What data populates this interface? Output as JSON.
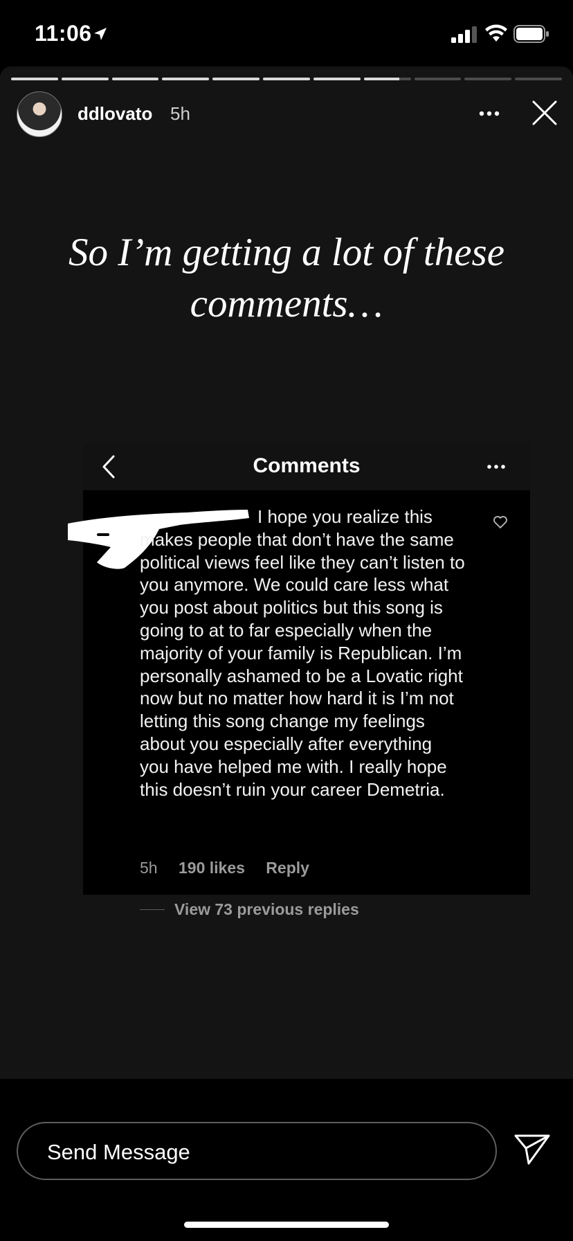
{
  "status_bar": {
    "time": "11:06"
  },
  "story": {
    "progress": {
      "segments": 11,
      "completed": 7,
      "current_fraction": 0.75
    },
    "username": "ddlovato",
    "time_ago": "5h",
    "headline": "So I’m getting a lot of these comments…"
  },
  "screenshot": {
    "title": "Comments",
    "comment_text": "I hope you realize this makes people that don’t have the same political views feel like they can’t listen to you anymore. We could care less what you post about politics but this song is going to at to far especially when the majority of your family is Republican. I’m personally ashamed to be a Lovatic right now but no matter how hard it is I’m not letting this song change my feelings about you especially after everything you have helped me with. I really hope this doesn’t ruin your career Demetria.",
    "meta": {
      "time": "5h",
      "likes": "190 likes",
      "reply": "Reply"
    },
    "view_replies": "View 73 previous replies"
  },
  "message_bar": {
    "placeholder": "Send Message"
  },
  "icons": {
    "location": "location-arrow-icon",
    "signal": "cellular-signal-icon",
    "wifi": "wifi-icon",
    "battery": "battery-icon",
    "more": "more-dots-icon",
    "close": "close-icon",
    "back": "chevron-left-icon",
    "heart": "heart-icon",
    "send": "paper-plane-icon"
  }
}
